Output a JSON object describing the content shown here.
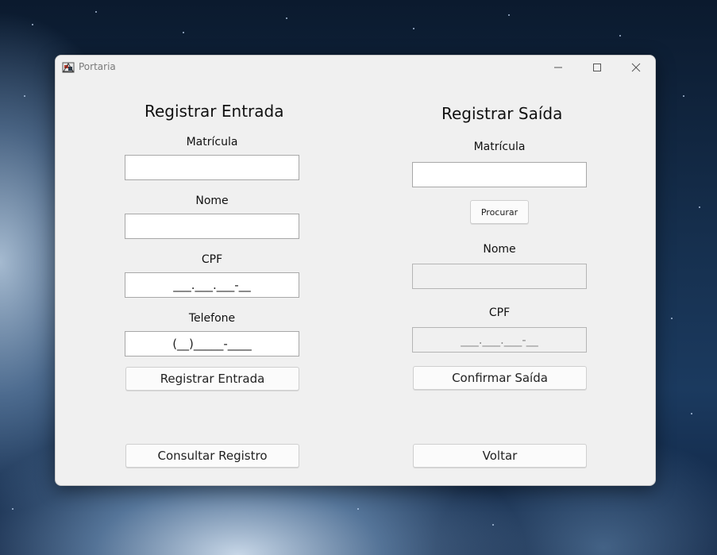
{
  "window": {
    "title": "Portaria"
  },
  "icons": {
    "app": "portaria-app-icon",
    "minimize": "minimize-icon",
    "maximize": "maximize-icon",
    "close": "close-icon"
  },
  "entrada": {
    "heading": "Registrar Entrada",
    "matricula_label": "Matrícula",
    "matricula_value": "",
    "nome_label": "Nome",
    "nome_value": "",
    "cpf_label": "CPF",
    "cpf_value": "___.___.___-__",
    "telefone_label": "Telefone",
    "telefone_value": "(__)_____-____",
    "register_button": "Registrar Entrada",
    "consult_button": "Consultar Registro"
  },
  "saida": {
    "heading": "Registrar Saída",
    "matricula_label": "Matrícula",
    "matricula_value": "",
    "search_button": "Procurar",
    "nome_label": "Nome",
    "nome_value": "",
    "cpf_label": "CPF",
    "cpf_value": "___.___.___-__",
    "confirm_button": "Confirmar Saída",
    "back_button": "Voltar"
  },
  "colors": {
    "window_bg": "#f0f0f0",
    "field_bg": "#ffffff",
    "disabled_field_bg": "#f0f0f0"
  }
}
